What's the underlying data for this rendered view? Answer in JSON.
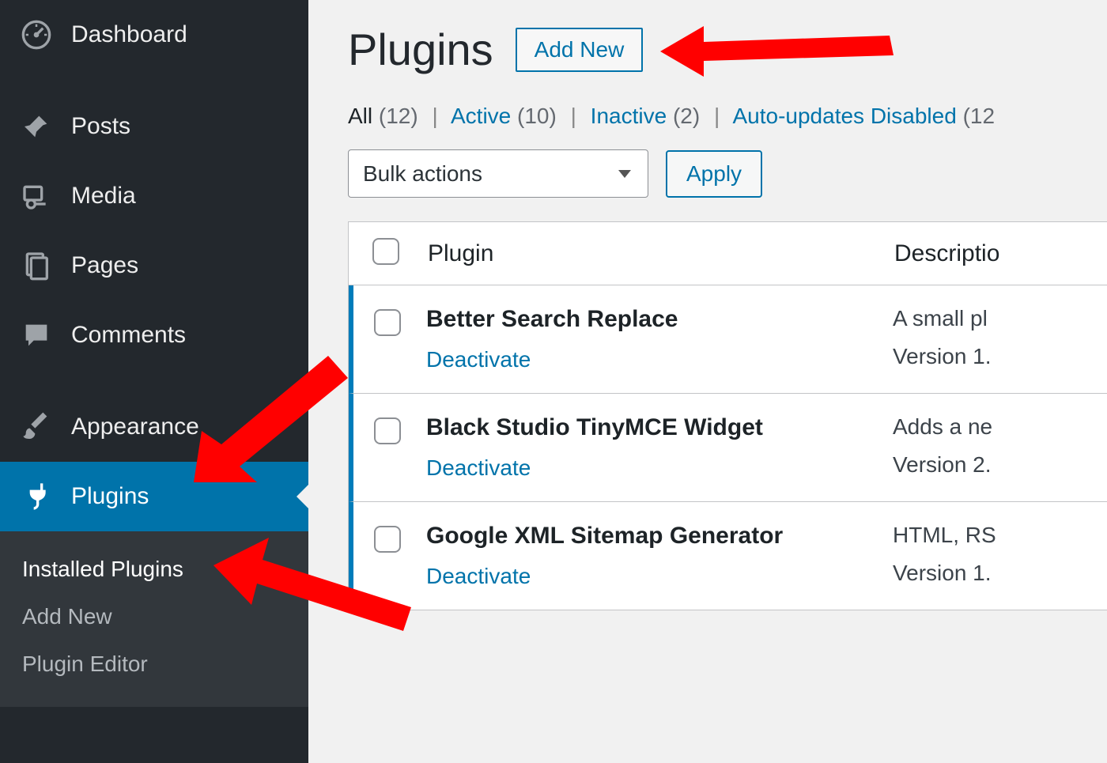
{
  "sidebar": {
    "items": [
      {
        "label": "Dashboard",
        "icon": "dashboard-icon"
      },
      {
        "label": "Posts",
        "icon": "pin-icon"
      },
      {
        "label": "Media",
        "icon": "media-icon"
      },
      {
        "label": "Pages",
        "icon": "pages-icon"
      },
      {
        "label": "Comments",
        "icon": "comments-icon"
      },
      {
        "label": "Appearance",
        "icon": "brush-icon"
      },
      {
        "label": "Plugins",
        "icon": "plug-icon"
      }
    ],
    "submenu": {
      "items": [
        {
          "label": "Installed Plugins",
          "current": true
        },
        {
          "label": "Add New",
          "current": false
        },
        {
          "label": "Plugin Editor",
          "current": false
        }
      ]
    }
  },
  "header": {
    "title": "Plugins",
    "add_new_label": "Add New"
  },
  "filters": {
    "all_label": "All",
    "all_count": "(12)",
    "active_label": "Active",
    "active_count": "(10)",
    "inactive_label": "Inactive",
    "inactive_count": "(2)",
    "auto_label": "Auto-updates Disabled",
    "auto_count": "(12"
  },
  "bulk": {
    "select_label": "Bulk actions",
    "apply_label": "Apply"
  },
  "table": {
    "col_plugin": "Plugin",
    "col_description": "Descriptio",
    "rows": [
      {
        "name": "Better Search Replace",
        "action": "Deactivate",
        "desc": "A small pl",
        "version": "Version 1."
      },
      {
        "name": "Black Studio TinyMCE Widget",
        "action": "Deactivate",
        "desc": "Adds a ne",
        "version": "Version 2."
      },
      {
        "name": "Google XML Sitemap Generator",
        "action": "Deactivate",
        "desc": "HTML, RS",
        "version": "Version 1."
      }
    ]
  }
}
